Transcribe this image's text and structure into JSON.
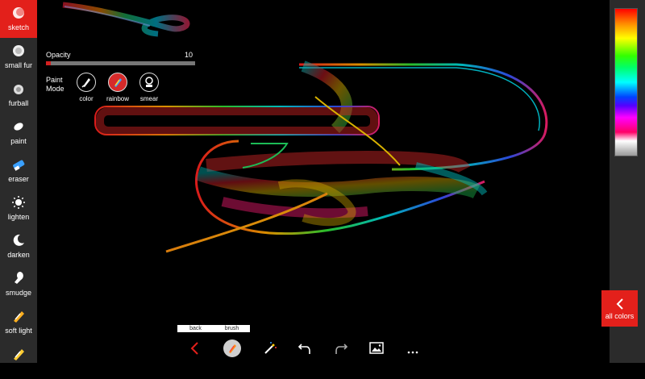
{
  "sidebar": {
    "items": [
      {
        "label": "sketch",
        "icon": "sketch-icon",
        "active": true
      },
      {
        "label": "small fur",
        "icon": "small-fur-icon"
      },
      {
        "label": "furball",
        "icon": "furball-icon"
      },
      {
        "label": "paint",
        "icon": "paint-icon"
      },
      {
        "label": "eraser",
        "icon": "eraser-icon"
      },
      {
        "label": "lighten",
        "icon": "lighten-icon"
      },
      {
        "label": "darken",
        "icon": "darken-icon"
      },
      {
        "label": "smudge",
        "icon": "smudge-icon"
      },
      {
        "label": "soft light",
        "icon": "soft-light-icon"
      },
      {
        "label": "",
        "icon": "brush-icon"
      }
    ]
  },
  "brush_panel": {
    "opacity_label": "Opacity",
    "opacity_value": "10",
    "opacity_fraction": 0.03,
    "paint_mode_label": "Paint Mode",
    "modes": [
      {
        "label": "color",
        "icon": "color-mode-icon"
      },
      {
        "label": "rainbow",
        "icon": "rainbow-mode-icon",
        "active": true
      },
      {
        "label": "smear",
        "icon": "smear-mode-icon"
      }
    ]
  },
  "right_panel": {
    "all_colors_label": "all colors",
    "icon": "chevron-left-icon"
  },
  "toolbar": {
    "tooltips": {
      "back": "back",
      "brush": "brush"
    },
    "buttons": [
      {
        "name": "back-button",
        "icon": "chevron-left-icon"
      },
      {
        "name": "brush-button",
        "icon": "brush-icon"
      },
      {
        "name": "magic-wand-button",
        "icon": "magic-wand-icon"
      },
      {
        "name": "undo-button",
        "icon": "undo-icon"
      },
      {
        "name": "redo-button",
        "icon": "redo-icon"
      },
      {
        "name": "image-button",
        "icon": "image-icon"
      },
      {
        "name": "more-button",
        "icon": "more-icon"
      }
    ]
  },
  "colors": {
    "accent": "#e3201b",
    "sidebar_bg": "#2b2b2b",
    "canvas_bg": "#000000"
  }
}
